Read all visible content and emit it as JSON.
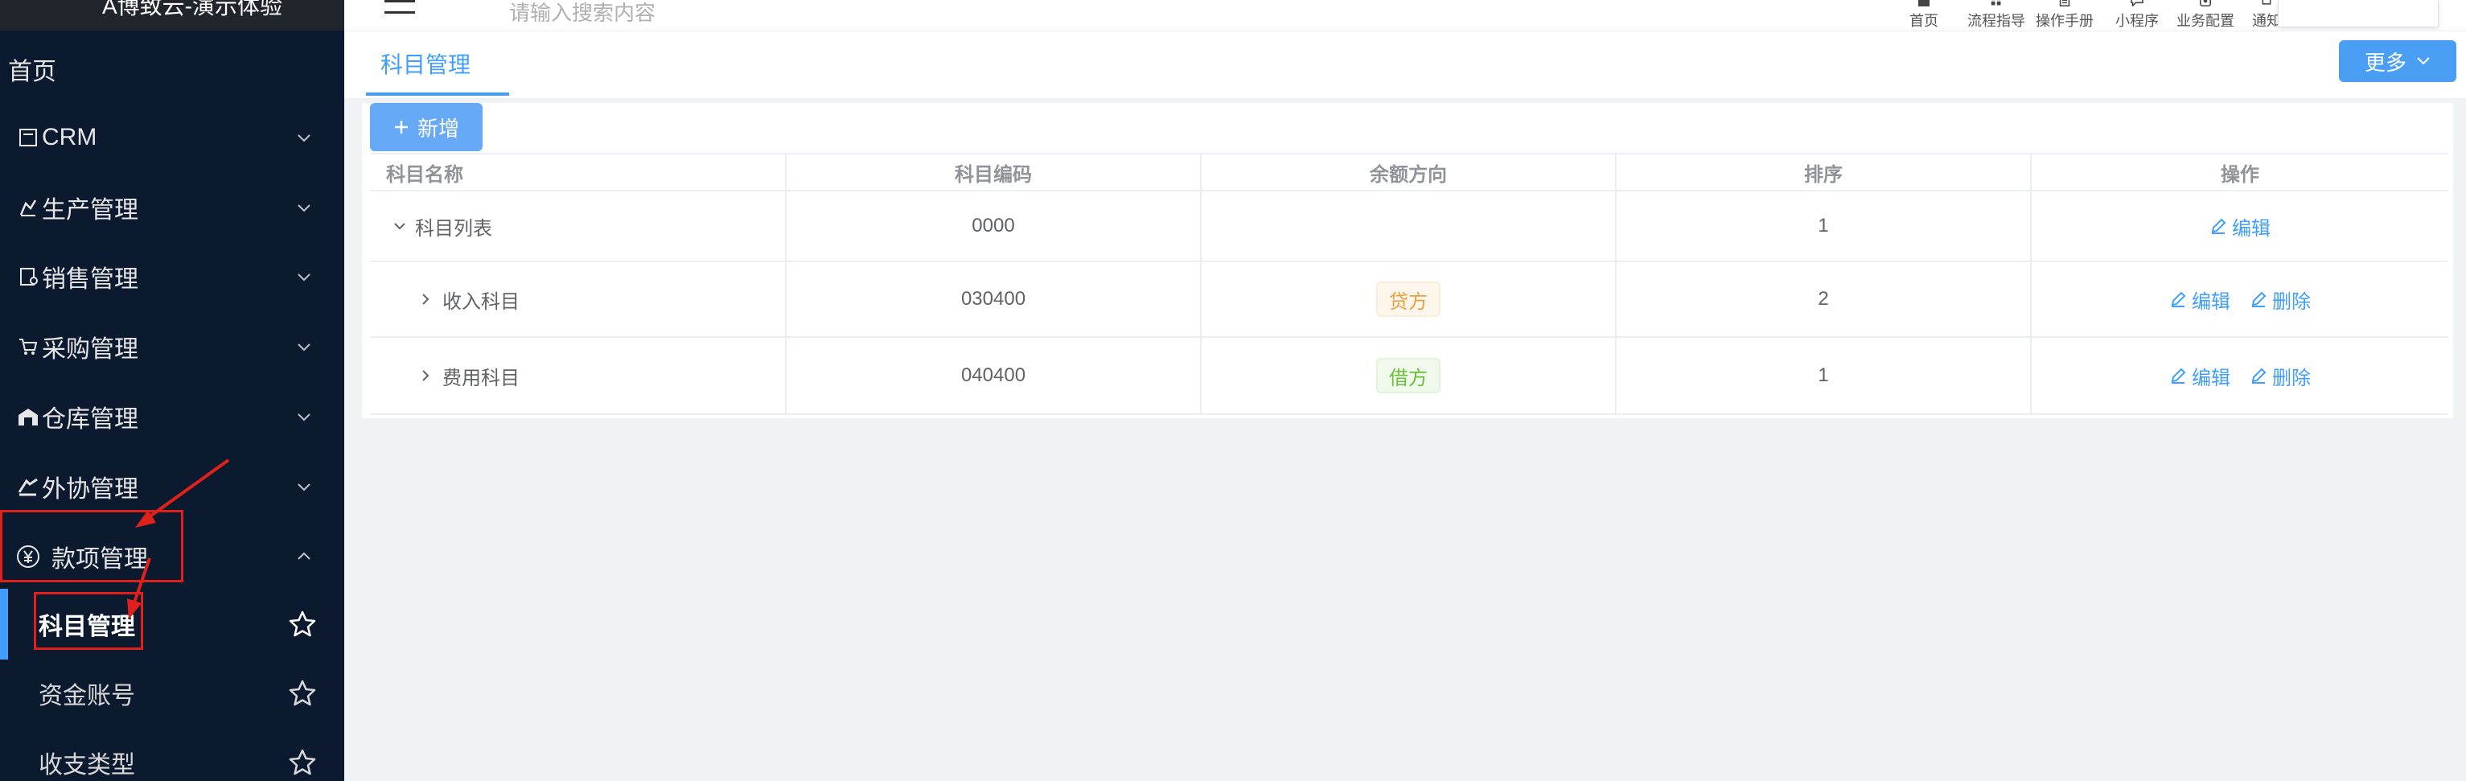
{
  "app": {
    "title": "A博致云-演示体验"
  },
  "sidebar": {
    "home": "首页",
    "menus": [
      {
        "label": "CRM",
        "icon": "crm-icon",
        "expanded": false
      },
      {
        "label": "生产管理",
        "icon": "production-icon",
        "expanded": false
      },
      {
        "label": "销售管理",
        "icon": "sales-icon",
        "expanded": false
      },
      {
        "label": "采购管理",
        "icon": "cart-icon",
        "expanded": false
      },
      {
        "label": "仓库管理",
        "icon": "warehouse-icon",
        "expanded": false
      },
      {
        "label": "外协管理",
        "icon": "outsource-icon",
        "expanded": false
      },
      {
        "label": "款项管理",
        "icon": "yen-icon",
        "expanded": true
      }
    ],
    "sub_items": [
      {
        "label": "科目管理",
        "active": true
      },
      {
        "label": "资金账号",
        "active": false
      },
      {
        "label": "收支类型",
        "active": false
      }
    ]
  },
  "header": {
    "search_placeholder": "请输入搜索内容",
    "nav": [
      {
        "label": "首页",
        "icon": "home-icon"
      },
      {
        "label": "流程指导",
        "icon": "grid-icon"
      },
      {
        "label": "操作手册",
        "icon": "document-icon"
      },
      {
        "label": "小程序",
        "icon": "chat-icon"
      },
      {
        "label": "业务配置",
        "icon": "config-icon"
      },
      {
        "label": "通知",
        "icon": "bell-icon"
      }
    ]
  },
  "tabs": {
    "active": "科目管理",
    "more_label": "更多"
  },
  "toolbar": {
    "add_label": "新增"
  },
  "table": {
    "headers": [
      "科目名称",
      "科目编码",
      "余额方向",
      "排序",
      "操作"
    ],
    "rows": [
      {
        "name": "科目列表",
        "code": "0000",
        "direction": "",
        "sort": "1",
        "expanded": true,
        "level": 0,
        "actions": [
          "编辑"
        ]
      },
      {
        "name": "收入科目",
        "code": "030400",
        "direction": "贷方",
        "direction_color": "#e6a23c",
        "sort": "2",
        "expanded": false,
        "level": 1,
        "actions": [
          "编辑",
          "删除"
        ]
      },
      {
        "name": "费用科目",
        "code": "040400",
        "direction": "借方",
        "direction_color": "#67c23a",
        "sort": "1",
        "expanded": false,
        "level": 1,
        "actions": [
          "编辑",
          "删除"
        ]
      }
    ]
  },
  "colors": {
    "primary": "#409eff",
    "sidebar_bg": "#0b1a2e",
    "annotation": "#e0201b"
  }
}
